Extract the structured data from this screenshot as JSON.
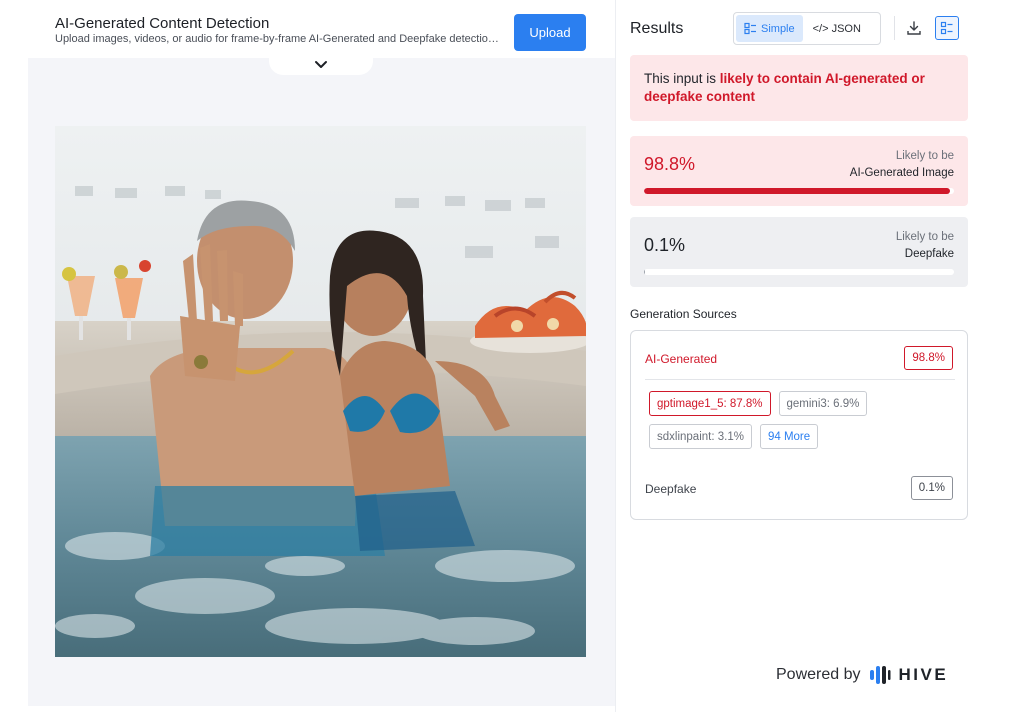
{
  "header": {
    "title": "AI-Generated Content Detection",
    "subtitle": "Upload images, videos, or audio for frame-by-frame AI-Generated and Deepfake detection with...",
    "upload_label": "Upload"
  },
  "results": {
    "title": "Results",
    "view_simple": "Simple",
    "view_json": "</> JSON",
    "verdict_prefix": "This input is ",
    "verdict_highlight": "likely to contain AI-generated or deepfake content",
    "scores": [
      {
        "value": "98.8%",
        "likely": "Likely to be",
        "label": "AI-Generated Image",
        "fraction": 0.988
      },
      {
        "value": "0.1%",
        "likely": "Likely to be",
        "label": "Deepfake",
        "fraction": 0.001
      }
    ]
  },
  "generation_sources": {
    "title": "Generation Sources",
    "ai_label": "AI-Generated",
    "ai_value": "98.8%",
    "chips": [
      "gptimage1_5: 87.8%",
      "gemini3: 6.9%",
      "sdxlinpaint: 3.1%"
    ],
    "more": "94 More",
    "deepfake_label": "Deepfake",
    "deepfake_value": "0.1%"
  },
  "footer": {
    "powered_by": "Powered by",
    "brand": "HIVE"
  },
  "colors": {
    "accent": "#2b7ff0",
    "alert_red": "#d0182a",
    "alert_bg": "#fde7e9"
  },
  "icons": [
    "chevron-down-icon",
    "simple-view-icon",
    "download-icon",
    "summary-view-icon",
    "hive-logo-icon"
  ]
}
